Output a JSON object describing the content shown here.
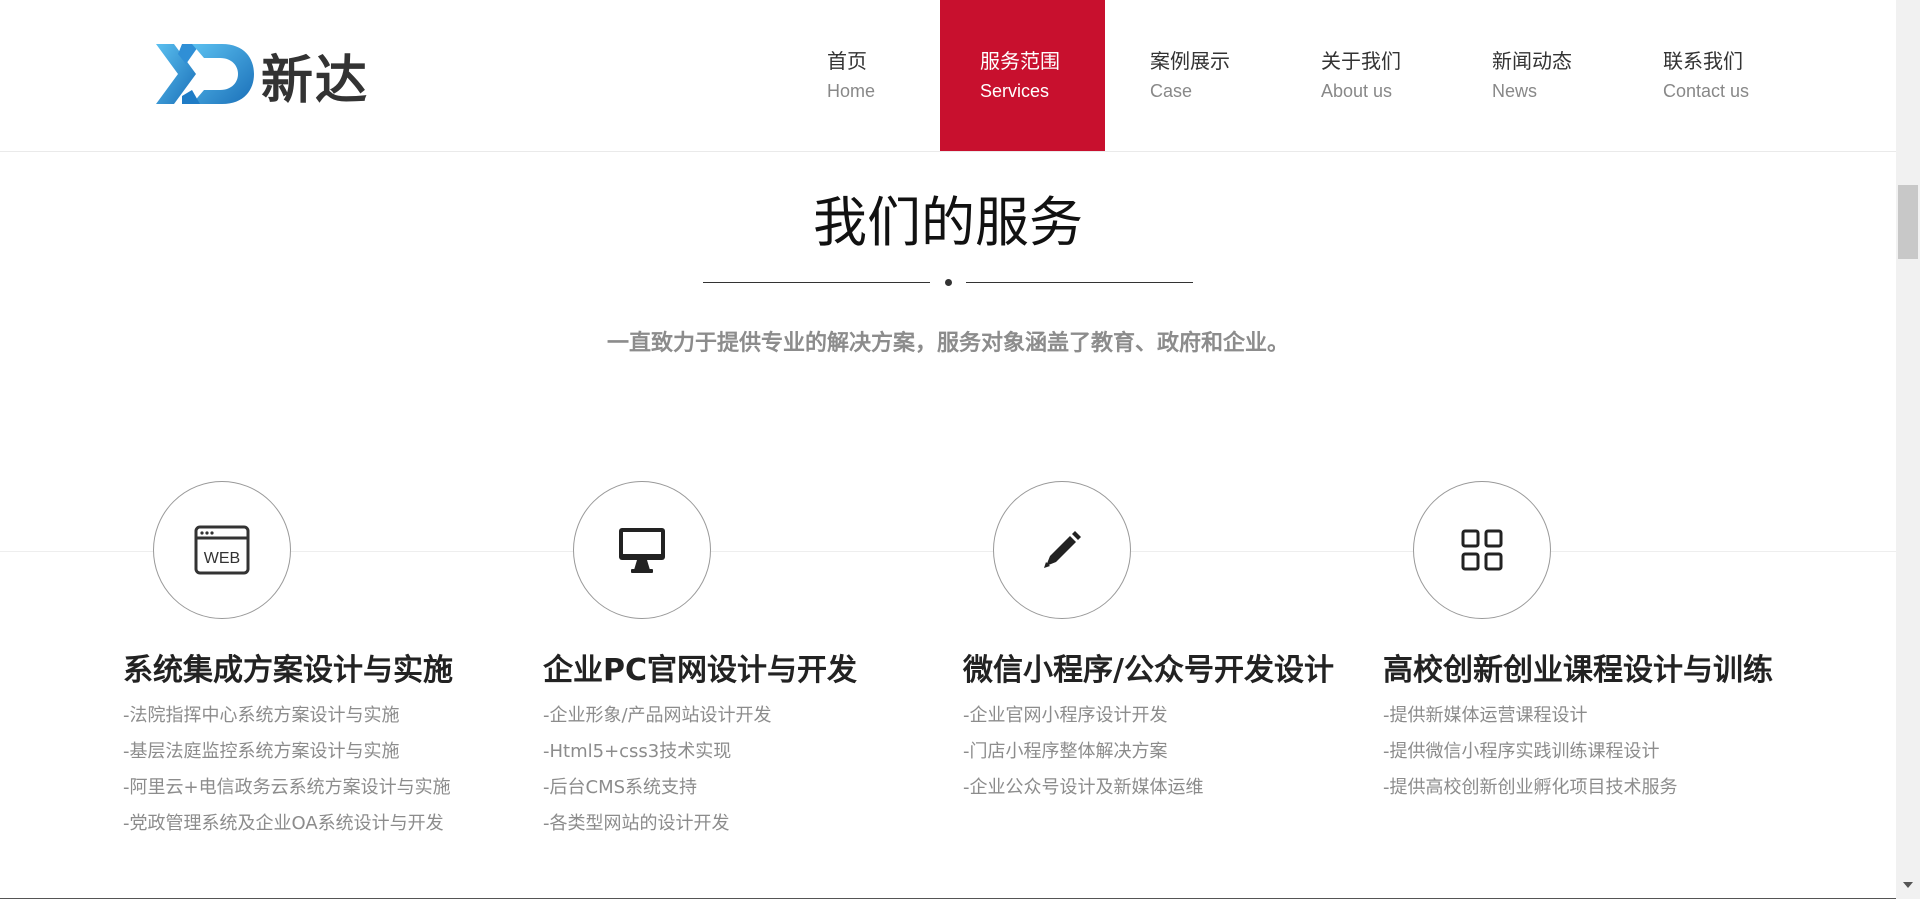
{
  "header": {
    "logo_text": "新达",
    "nav": [
      {
        "cn": "首页",
        "en": "Home"
      },
      {
        "cn": "服务范围",
        "en": "Services"
      },
      {
        "cn": "案例展示",
        "en": "Case"
      },
      {
        "cn": "关于我们",
        "en": "About us"
      },
      {
        "cn": "新闻动态",
        "en": "News"
      },
      {
        "cn": "联系我们",
        "en": "Contact us"
      }
    ],
    "active_nav": "服务范围",
    "accent_color": "#c8102e"
  },
  "section": {
    "title": "我们的服务",
    "subtitle": "一直致力于提供专业的解决方案，服务对象涵盖了教育、政府和企业。"
  },
  "services": [
    {
      "icon": "web-browser-icon",
      "icon_label": "WEB",
      "title": "系统集成方案设计与实施",
      "items": [
        "-法院指挥中心系统方案设计与实施",
        "-基层法庭监控系统方案设计与实施",
        "-阿里云+电信政务云系统方案设计与实施",
        "-党政管理系统及企业OA系统设计与开发"
      ]
    },
    {
      "icon": "monitor-icon",
      "title": "企业PC官网设计与开发",
      "items": [
        "-企业形象/产品网站设计开发",
        "-Html5+css3技术实现",
        "-后台CMS系统支持",
        "-各类型网站的设计开发"
      ]
    },
    {
      "icon": "pencil-icon",
      "title": "微信小程序/公众号开发设计",
      "items": [
        "-企业官网小程序设计开发",
        "-门店小程序整体解决方案",
        "-企业公众号设计及新媒体运维"
      ]
    },
    {
      "icon": "grid-apps-icon",
      "title": "高校创新创业课程设计与训练",
      "items": [
        "-提供新媒体运营课程设计",
        "-提供微信小程序实践训练课程设计",
        "-提供高校创新创业孵化项目技术服务"
      ]
    }
  ]
}
